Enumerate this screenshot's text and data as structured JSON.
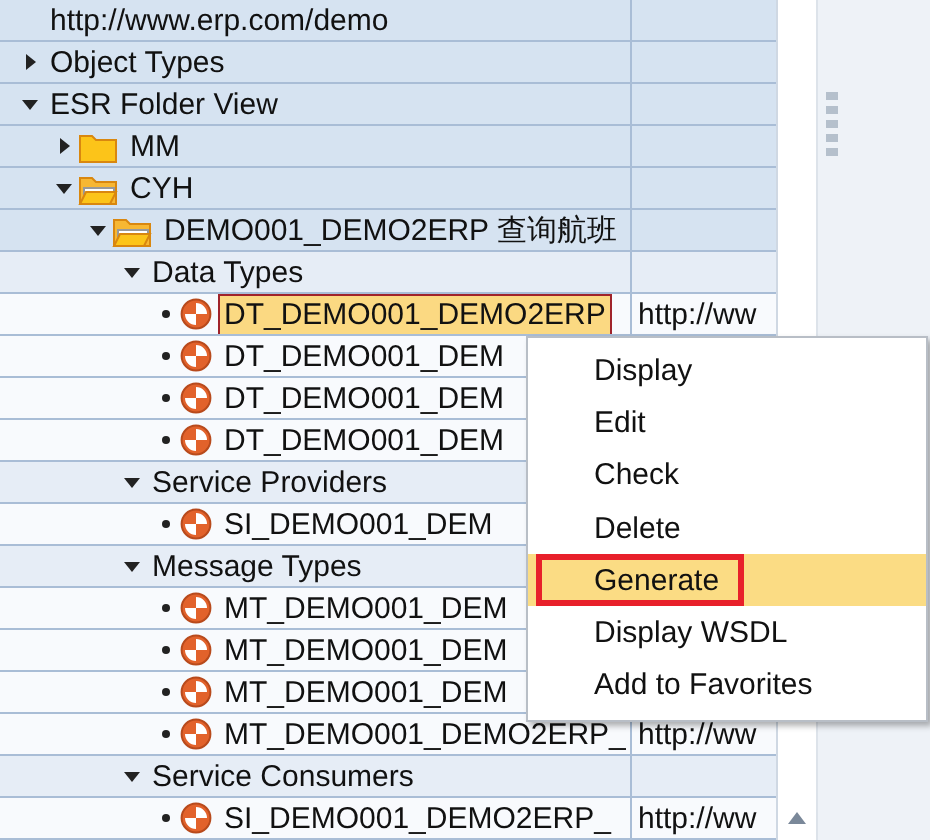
{
  "tree": {
    "nodes": [
      {
        "label": "http://www.erp.com/demo"
      },
      {
        "label": "Object Types",
        "expanded": false
      },
      {
        "label": "ESR Folder View",
        "expanded": true,
        "children": [
          {
            "label": "MM",
            "kind": "folder",
            "expanded": false
          },
          {
            "label": "CYH",
            "kind": "folder-open",
            "expanded": true,
            "children": [
              {
                "label": "DEMO001_DEMO2ERP 查询航班",
                "kind": "folder-open",
                "expanded": true,
                "children": [
                  {
                    "label": "Data Types",
                    "expanded": true,
                    "children": [
                      {
                        "label": "DT_DEMO001_DEMO2ERP",
                        "kind": "object",
                        "url": "http://ww",
                        "selected": true
                      },
                      {
                        "label": "DT_DEMO001_DEM",
                        "kind": "object",
                        "selected": false
                      },
                      {
                        "label": "DT_DEMO001_DEM",
                        "kind": "object",
                        "selected": false
                      },
                      {
                        "label": "DT_DEMO001_DEM",
                        "kind": "object",
                        "selected": false
                      }
                    ]
                  },
                  {
                    "label": "Service Providers",
                    "expanded": true,
                    "children": [
                      {
                        "label": "SI_DEMO001_DEM",
                        "kind": "object",
                        "selected": false
                      }
                    ]
                  },
                  {
                    "label": "Message Types",
                    "expanded": true,
                    "children": [
                      {
                        "label": "MT_DEMO001_DEM",
                        "kind": "object",
                        "selected": false
                      },
                      {
                        "label": "MT_DEMO001_DEM",
                        "kind": "object",
                        "selected": false
                      },
                      {
                        "label": "MT_DEMO001_DEM",
                        "kind": "object",
                        "selected": false
                      },
                      {
                        "label": "MT_DEMO001_DEMO2ERP_",
                        "kind": "object",
                        "url": "http://ww",
                        "selected": false
                      }
                    ]
                  },
                  {
                    "label": "Service Consumers",
                    "expanded": true,
                    "children": [
                      {
                        "label": "SI_DEMO001_DEMO2ERP_",
                        "kind": "object",
                        "url": "http://ww",
                        "selected": false
                      }
                    ]
                  }
                ]
              }
            ]
          }
        ]
      }
    ]
  },
  "context_menu": {
    "items": [
      {
        "label": "Display",
        "selected": false
      },
      {
        "label": "Edit",
        "selected": false
      },
      {
        "label": "Check",
        "selected": false
      },
      {
        "label": "Delete",
        "selected": false
      },
      {
        "label": "Generate",
        "selected": true
      },
      {
        "label": "Display WSDL",
        "selected": false
      },
      {
        "label": "Add to Favorites",
        "selected": false
      }
    ]
  }
}
